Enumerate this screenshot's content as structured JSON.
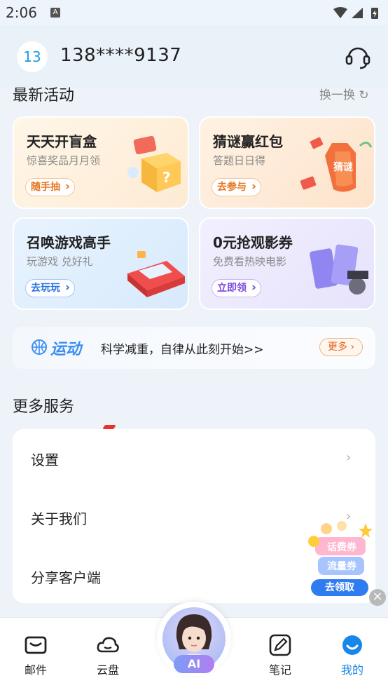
{
  "status_bar": {
    "time": "2:06",
    "notification_icon": "A"
  },
  "header": {
    "avatar_text": "13",
    "phone": "138****9137",
    "support_icon": "headset-icon"
  },
  "activities": {
    "title": "最新活动",
    "refresh_label": "换一换",
    "cards": [
      {
        "title": "天天开盲盒",
        "subtitle": "惊喜奖品月月领",
        "button": "随手抽"
      },
      {
        "title": "猜谜赢红包",
        "subtitle": "答题日日得",
        "button": "去参与",
        "image_text": "猜谜"
      },
      {
        "title": "召唤游戏高手",
        "subtitle": "玩游戏 兑好礼",
        "button": "去玩玩"
      },
      {
        "title": "0元抢观影券",
        "subtitle": "免费看热映电影",
        "button": "立即领"
      }
    ]
  },
  "sports": {
    "logo": "运动",
    "text": "科学减重，自律从此刻开始>>",
    "more": "更多"
  },
  "services": {
    "title": "更多服务",
    "items": [
      {
        "label": "设置"
      },
      {
        "label": "关于我们"
      },
      {
        "label": "分享客户端"
      }
    ]
  },
  "coupon": {
    "line1": "话费券",
    "line2": "流量券",
    "button": "去领取"
  },
  "bottom_nav": {
    "items": [
      {
        "label": "邮件",
        "icon": "mail-icon"
      },
      {
        "label": "云盘",
        "icon": "cloud-icon"
      },
      {
        "label": "AI",
        "icon": "ai-assistant-icon"
      },
      {
        "label": "笔记",
        "icon": "note-icon"
      },
      {
        "label": "我的",
        "icon": "profile-icon",
        "active": true
      }
    ]
  },
  "colors": {
    "accent": "#1788ea",
    "orange": "#e7741d",
    "blue": "#2873e0",
    "purple": "#7b4ae0"
  }
}
